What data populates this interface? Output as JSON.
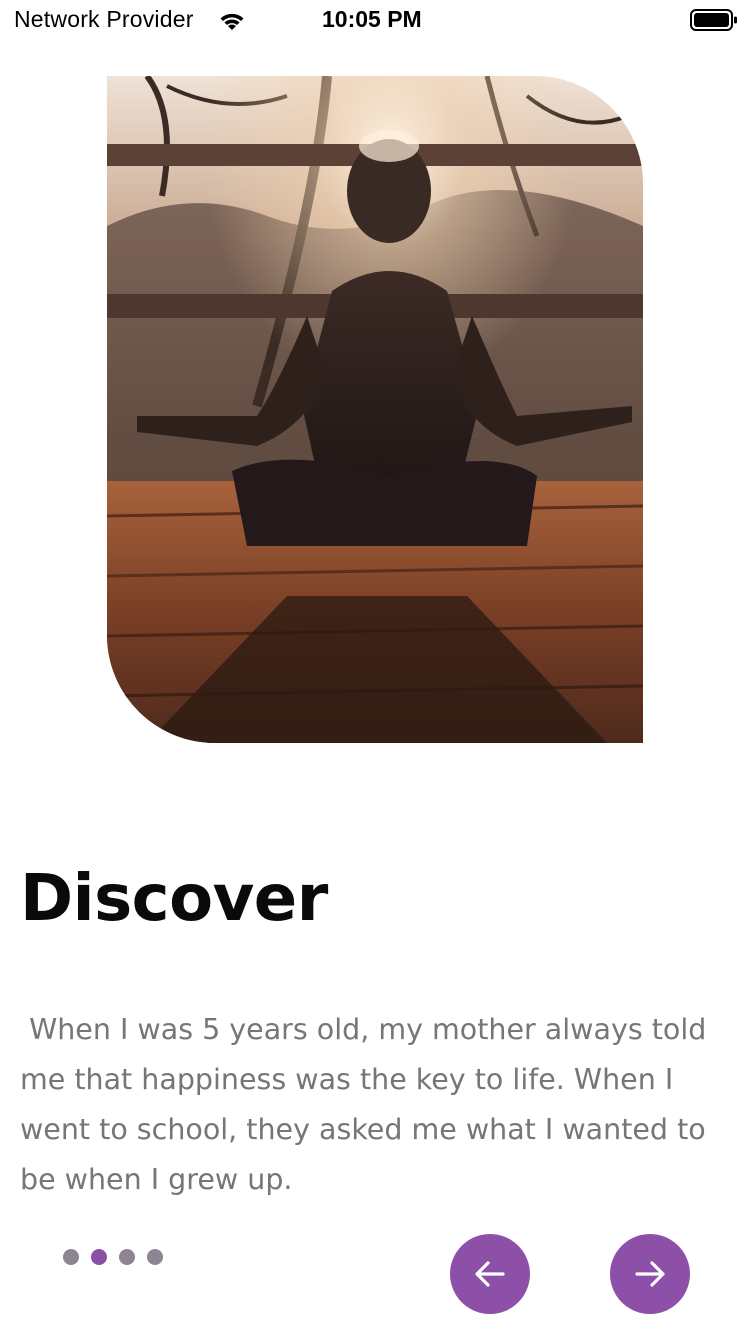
{
  "status_bar": {
    "carrier": "Network Provider",
    "time": "10:05 PM",
    "wifi_icon": "wifi-icon",
    "battery_icon": "battery-icon"
  },
  "hero": {
    "image": "meditation-silhouette-photo"
  },
  "onboarding": {
    "title": "Discover",
    "description": " When I was 5 years old, my mother always told me that happiness was the key to life. When I went to school, they asked me what I wanted to be when I grew up.",
    "pager": {
      "total": 4,
      "active_index": 1
    }
  },
  "nav": {
    "prev_icon": "arrow-left-icon",
    "next_icon": "arrow-right-icon"
  },
  "colors": {
    "accent": "#8c50a8",
    "dot_inactive": "#8e8592",
    "text_body": "#767676",
    "text_title": "#0a0a0a"
  }
}
